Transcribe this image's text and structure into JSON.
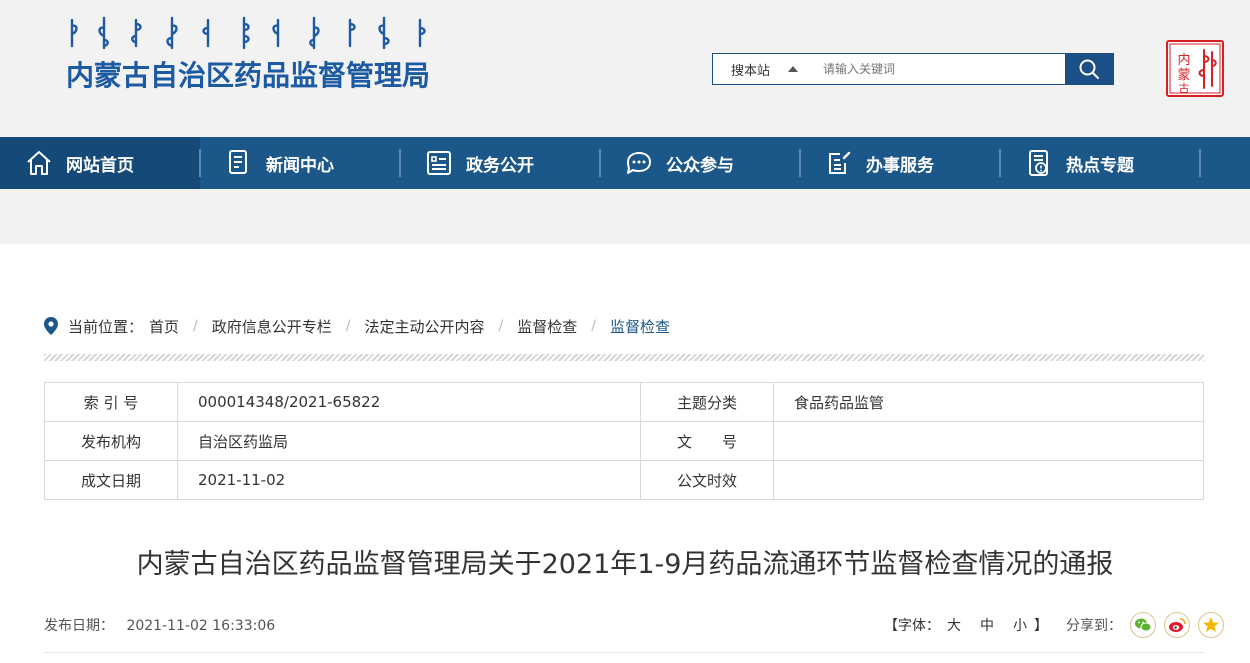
{
  "header": {
    "site_title": "内蒙古自治区药品监督管理局",
    "search": {
      "scope_label": "搜本站",
      "placeholder": "请输入关键词"
    },
    "seal_text": "内蒙古"
  },
  "nav": {
    "items": [
      {
        "label": "网站首页",
        "icon": "home-icon"
      },
      {
        "label": "新闻中心",
        "icon": "news-icon"
      },
      {
        "label": "政务公开",
        "icon": "document-list-icon"
      },
      {
        "label": "公众参与",
        "icon": "chat-icon"
      },
      {
        "label": "办事服务",
        "icon": "edit-form-icon"
      },
      {
        "label": "热点专题",
        "icon": "alert-file-icon"
      }
    ]
  },
  "breadcrumb": {
    "prefix": "当前位置：",
    "items": [
      "首页",
      "政府信息公开专栏",
      "法定主动公开内容",
      "监督检查",
      "监督检查"
    ]
  },
  "meta": {
    "index_label": "索 引 号",
    "index_value": "000014348/2021-65822",
    "topic_label": "主题分类",
    "topic_value": "食品药品监管",
    "issuer_label": "发布机构",
    "issuer_value": "自治区药监局",
    "docno_label": "文　　号",
    "docno_value": "",
    "date_label": "成文日期",
    "date_value": "2021-11-02",
    "validity_label": "公文时效",
    "validity_value": ""
  },
  "article": {
    "title": "内蒙古自治区药品监督管理局关于2021年1-9月药品流通环节监督检查情况的通报",
    "publish_label": "发布日期：",
    "publish_value": "2021-11-02 16:33:06",
    "font_prefix": "【字体：",
    "font_large": "大",
    "font_medium": "中",
    "font_small": "小",
    "font_suffix": "】",
    "share_label": "分享到："
  },
  "colors": {
    "nav_bg": "#1c5789",
    "title_blue": "#1c5aa3",
    "seal_red": "#d71f26"
  }
}
